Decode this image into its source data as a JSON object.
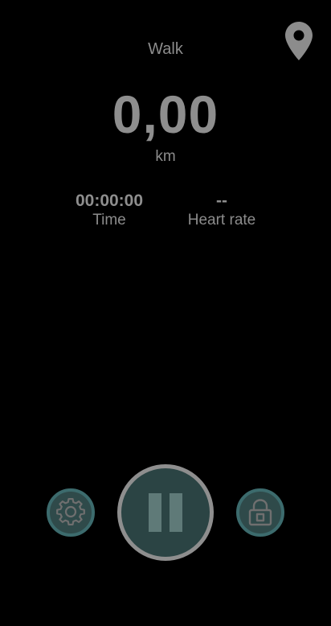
{
  "header": {
    "activity_type": "Walk",
    "location_icon": "map-pin-icon"
  },
  "distance": {
    "value": "0,00",
    "unit": "km"
  },
  "stats": {
    "time": {
      "value": "00:00:00",
      "label": "Time"
    },
    "heart_rate": {
      "value": "--",
      "label": "Heart rate"
    }
  },
  "controls": {
    "settings_icon": "gear-icon",
    "pause_icon": "pause-icon",
    "lock_icon": "lock-icon"
  },
  "colors": {
    "background": "#000000",
    "text": "#8c8c8c",
    "button_fill": "#2f4a4a",
    "button_ring": "#3c6b6d",
    "pause_ring": "#8e8e8e"
  }
}
